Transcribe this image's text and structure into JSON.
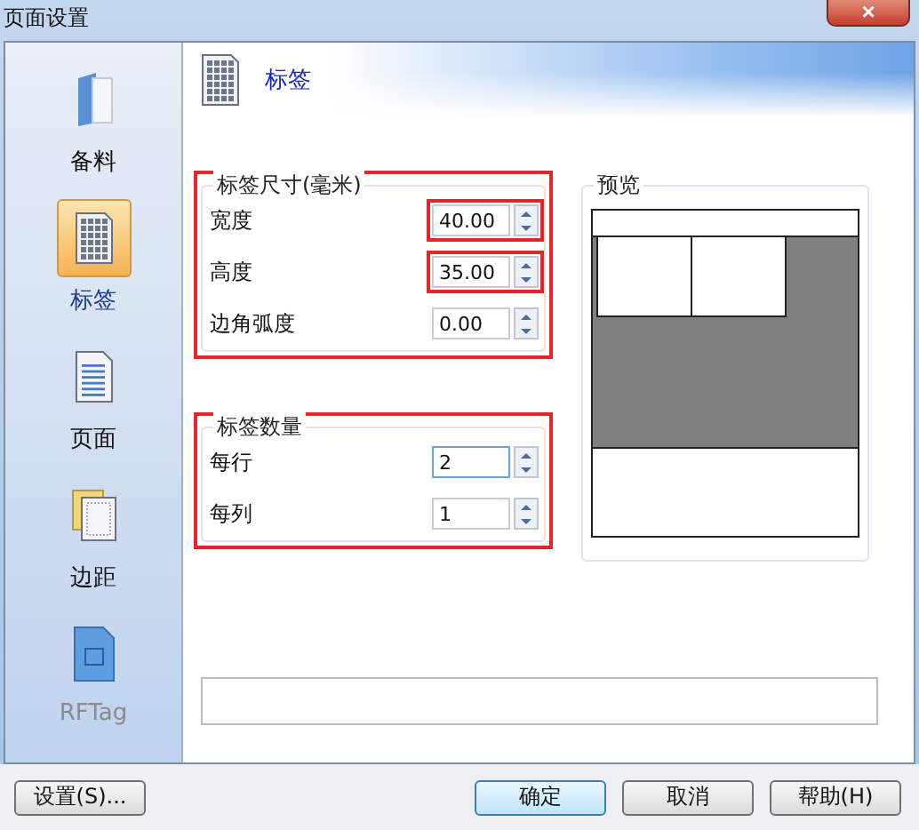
{
  "window": {
    "title": "页面设置",
    "close": "×"
  },
  "sidebar": {
    "items": [
      {
        "label": "备料",
        "kind": "folder",
        "selected": false,
        "disabled": false
      },
      {
        "label": "标签",
        "kind": "grid",
        "selected": true,
        "disabled": false
      },
      {
        "label": "页面",
        "kind": "page",
        "selected": false,
        "disabled": false
      },
      {
        "label": "边距",
        "kind": "margin",
        "selected": false,
        "disabled": false
      },
      {
        "label": "RFTag",
        "kind": "rf",
        "selected": false,
        "disabled": true
      }
    ]
  },
  "header": {
    "title": "标签"
  },
  "groups": [
    {
      "title": "标签尺寸(毫米)",
      "highlighted": true,
      "fields": [
        {
          "label": "宽度",
          "value": "40.00",
          "highlighted": true,
          "focused": false
        },
        {
          "label": "高度",
          "value": "35.00",
          "highlighted": true,
          "focused": false
        },
        {
          "label": "边角弧度",
          "value": "0.00",
          "highlighted": false,
          "focused": false
        }
      ]
    },
    {
      "title": "标签数量",
      "highlighted": true,
      "fields": [
        {
          "label": "每行",
          "value": "2",
          "highlighted": false,
          "focused": true
        },
        {
          "label": "每列",
          "value": "1",
          "highlighted": false,
          "focused": false
        }
      ]
    }
  ],
  "preview": {
    "title": "预览"
  },
  "buttons": [
    {
      "label": "设置(S)...",
      "default": false
    },
    {
      "label": "确定",
      "default": true
    },
    {
      "label": "取消",
      "default": false
    },
    {
      "label": "帮助(H)",
      "default": false
    }
  ]
}
